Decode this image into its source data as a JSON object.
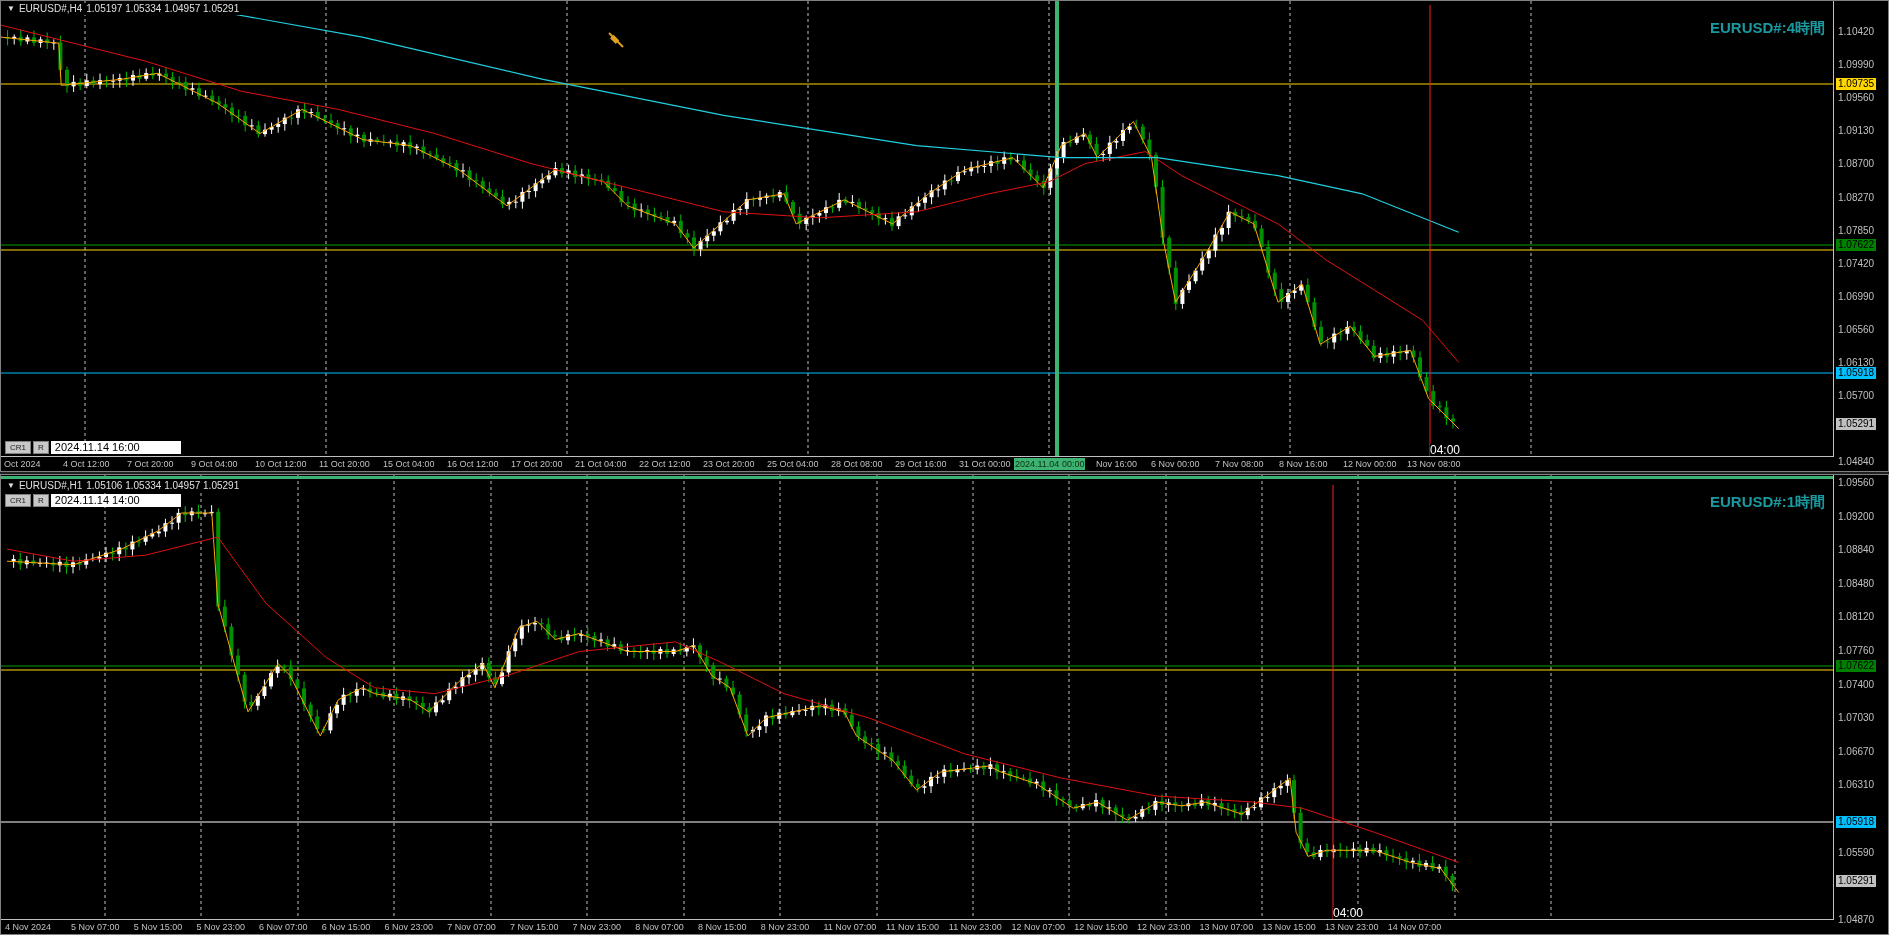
{
  "charts": [
    {
      "header": {
        "menu_glyph": "▼",
        "symbol": "EURUSD#,H4",
        "ohlc": "1.05197 1.05334 1.04957 1.05291"
      },
      "label": "EURUSD#:4時間",
      "buttons": [
        "CR1",
        "R"
      ],
      "date_box": "2024.11.14 16:00",
      "crosshair_time": "04:00",
      "price_ticks": [
        "1.10420",
        "1.09990",
        "1.09560",
        "1.09130",
        "1.08700",
        "1.08270",
        "1.07850",
        "1.07420",
        "1.06990",
        "1.06560",
        "1.06130",
        "1.05700",
        "1.04840"
      ],
      "price_markers": [
        {
          "text": "1.09735",
          "color": "#ffd700"
        },
        {
          "text": "1.07622",
          "color": "#008000"
        },
        {
          "text": "1.05918",
          "color": "#00bfff"
        },
        {
          "text": "1.05291",
          "color": "#c0c0c0"
        }
      ],
      "time_labels": [
        {
          "text": "Oct 2024",
          "highlighted": false
        },
        {
          "text": "4 Oct 12:00",
          "highlighted": false
        },
        {
          "text": "7 Oct 20:00",
          "highlighted": false
        },
        {
          "text": "9 Oct 04:00",
          "highlighted": false
        },
        {
          "text": "10 Oct 12:00",
          "highlighted": false
        },
        {
          "text": "11 Oct 20:00",
          "highlighted": false
        },
        {
          "text": "15 Oct 04:00",
          "highlighted": false
        },
        {
          "text": "16 Oct 12:00",
          "highlighted": false
        },
        {
          "text": "17 Oct 20:00",
          "highlighted": false
        },
        {
          "text": "21 Oct 04:00",
          "highlighted": false
        },
        {
          "text": "22 Oct 12:00",
          "highlighted": false
        },
        {
          "text": "23 Oct 20:00",
          "highlighted": false
        },
        {
          "text": "25 Oct 04:00",
          "highlighted": false
        },
        {
          "text": "28 Oct 08:00",
          "highlighted": false
        },
        {
          "text": "29 Oct 16:00",
          "highlighted": false
        },
        {
          "text": "31 Oct 00:00",
          "highlighted": false
        },
        {
          "text": "2024.11.04 00:00",
          "highlighted": true
        },
        {
          "text": "Nov 16:00",
          "highlighted": false
        },
        {
          "text": "6 Nov 00:00",
          "highlighted": false
        },
        {
          "text": "7 Nov 08:00",
          "highlighted": false
        },
        {
          "text": "8 Nov 16:00",
          "highlighted": false
        },
        {
          "text": "12 Nov 00:00",
          "highlighted": false
        },
        {
          "text": "13 Nov 08:00",
          "highlighted": false
        }
      ]
    },
    {
      "header": {
        "menu_glyph": "▼",
        "symbol": "EURUSD#,H1",
        "ohlc": "1.05106 1.05334 1.04957 1.05291"
      },
      "label": "EURUSD#:1時間",
      "buttons": [
        "CR1",
        "R"
      ],
      "date_box": "2024.11.14 14:00",
      "crosshair_time": "04:00",
      "price_ticks": [
        "1.09560",
        "1.09200",
        "1.08840",
        "1.08480",
        "1.08120",
        "1.07760",
        "1.07400",
        "1.07030",
        "1.06670",
        "1.06310",
        "1.05590",
        "1.04870"
      ],
      "price_markers": [
        {
          "text": "1.07622",
          "color": "#008000"
        },
        {
          "text": "1.05918",
          "color": "#00bfff"
        },
        {
          "text": "1.05291",
          "color": "#c0c0c0"
        }
      ],
      "time_labels": [
        {
          "text": "4 Nov 2024",
          "highlighted": false
        },
        {
          "text": "5 Nov 07:00",
          "highlighted": false
        },
        {
          "text": "5 Nov 15:00",
          "highlighted": false
        },
        {
          "text": "5 Nov 23:00",
          "highlighted": false
        },
        {
          "text": "6 Nov 07:00",
          "highlighted": false
        },
        {
          "text": "6 Nov 15:00",
          "highlighted": false
        },
        {
          "text": "6 Nov 23:00",
          "highlighted": false
        },
        {
          "text": "7 Nov 07:00",
          "highlighted": false
        },
        {
          "text": "7 Nov 15:00",
          "highlighted": false
        },
        {
          "text": "7 Nov 23:00",
          "highlighted": false
        },
        {
          "text": "8 Nov 07:00",
          "highlighted": false
        },
        {
          "text": "8 Nov 15:00",
          "highlighted": false
        },
        {
          "text": "8 Nov 23:00",
          "highlighted": false
        },
        {
          "text": "11 Nov 07:00",
          "highlighted": false
        },
        {
          "text": "11 Nov 15:00",
          "highlighted": false
        },
        {
          "text": "11 Nov 23:00",
          "highlighted": false
        },
        {
          "text": "12 Nov 07:00",
          "highlighted": false
        },
        {
          "text": "12 Nov 15:00",
          "highlighted": false
        },
        {
          "text": "12 Nov 23:00",
          "highlighted": false
        },
        {
          "text": "13 Nov 07:00",
          "highlighted": false
        },
        {
          "text": "13 Nov 15:00",
          "highlighted": false
        },
        {
          "text": "13 Nov 23:00",
          "highlighted": false
        },
        {
          "text": "14 Nov 07:00",
          "highlighted": false
        }
      ]
    }
  ]
}
